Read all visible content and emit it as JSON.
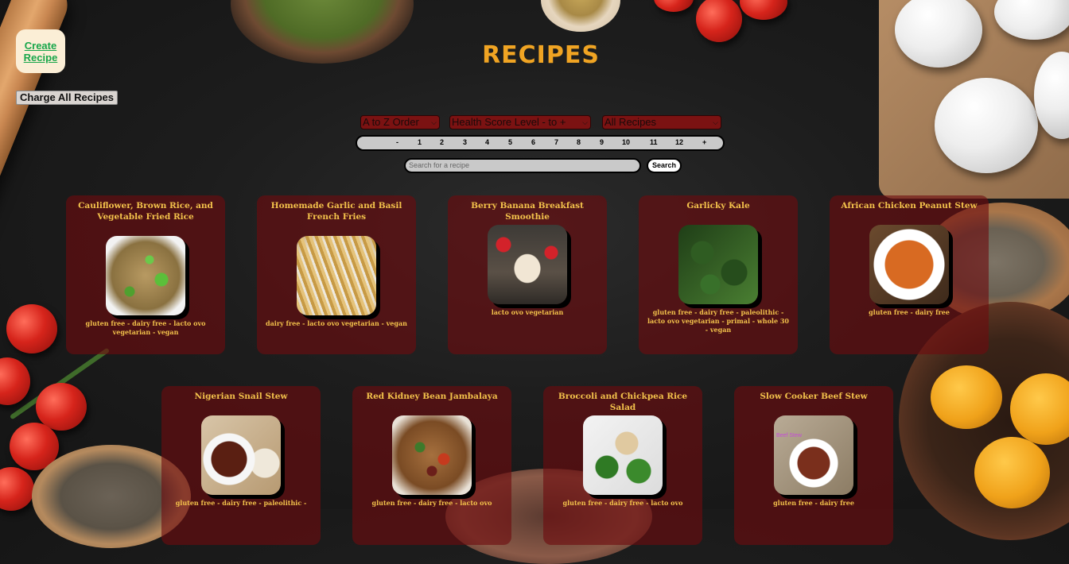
{
  "header": {
    "title": "RECIPES",
    "create_label_line1": "Create",
    "create_label_line2": "Recipe",
    "charge_all_label": "Charge All Recipes"
  },
  "filters": {
    "sort_order": "A to Z Order",
    "health_score": "Health Score Level - to +",
    "recipe_type": "All Recipes"
  },
  "pagination": {
    "prev": "-",
    "pages": [
      "1",
      "2",
      "3",
      "4",
      "5",
      "6",
      "7",
      "8",
      "9",
      "10",
      "11",
      "12"
    ],
    "next": "+"
  },
  "search": {
    "placeholder": "Search for a recipe",
    "button_label": "Search"
  },
  "recipes": [
    {
      "title": "Cauliflower, Brown Rice, and Vegetable Fried Rice",
      "diets": "gluten free - dairy free - lacto ovo vegetarian - vegan",
      "image": "fried-rice"
    },
    {
      "title": "Homemade Garlic and Basil French Fries",
      "diets": "dairy free - lacto ovo vegetarian - vegan",
      "image": "french-fries"
    },
    {
      "title": "Berry Banana Breakfast Smoothie",
      "diets": "lacto ovo vegetarian",
      "image": "smoothie"
    },
    {
      "title": "Garlicky Kale",
      "diets": "gluten free - dairy free - paleolithic - lacto ovo vegetarian - primal - whole 30 - vegan",
      "image": "kale"
    },
    {
      "title": "African Chicken Peanut Stew",
      "diets": "gluten free - dairy free",
      "image": "peanut-stew"
    },
    {
      "title": "Nigerian Snail Stew",
      "diets": "gluten free - dairy free - paleolithic -",
      "image": "snail-stew"
    },
    {
      "title": "Red Kidney Bean Jambalaya",
      "diets": "gluten free - dairy free - lacto ovo",
      "image": "jambalaya"
    },
    {
      "title": "Broccoli and Chickpea Rice Salad",
      "diets": "gluten free - dairy free - lacto ovo",
      "image": "rice-salad"
    },
    {
      "title": "Slow Cooker Beef Stew",
      "diets": "gluten free - dairy free",
      "image": "beef-stew",
      "image_text": "Beef Stew"
    }
  ]
}
